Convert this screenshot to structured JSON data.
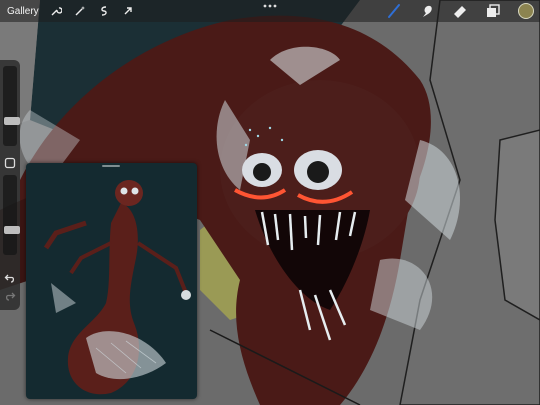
{
  "toolbar": {
    "gallery_label": "Gallery",
    "left_icons": [
      "wrench-icon",
      "magic-wand-icon",
      "selection-icon",
      "transform-arrow-icon"
    ],
    "right_icons": [
      "brush-icon",
      "smudge-icon",
      "eraser-icon",
      "layers-icon"
    ],
    "brush_color": "#2f6fd6",
    "current_color": "#8c8450"
  },
  "sidebar": {
    "size_slider": 0.29,
    "opacity_slider": 0.29
  },
  "reference": {
    "background": "#142a30"
  }
}
